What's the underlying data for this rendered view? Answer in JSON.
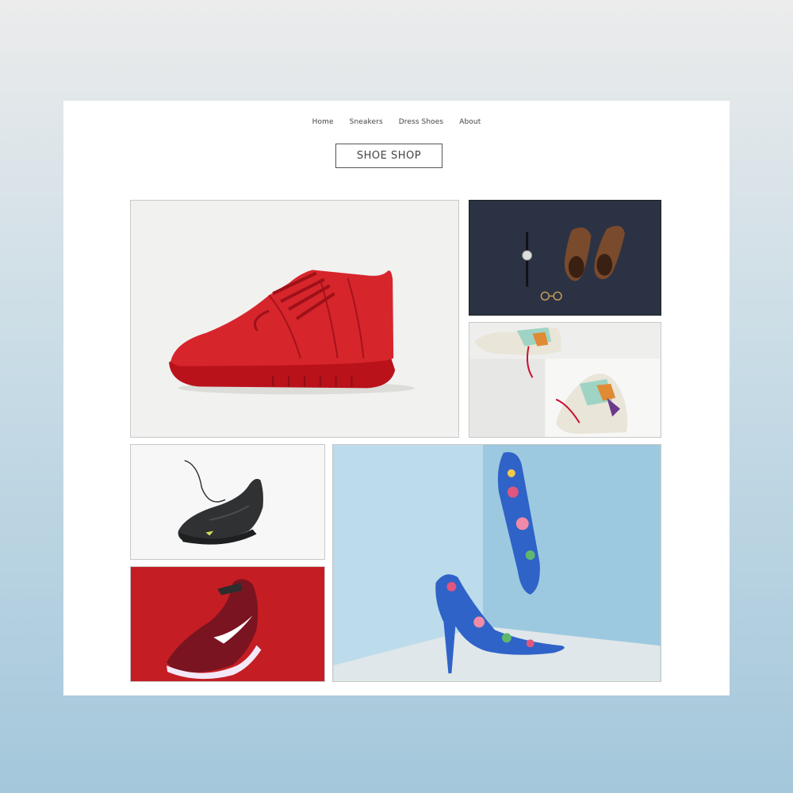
{
  "nav": {
    "items": [
      {
        "label": "Home"
      },
      {
        "label": "Sneakers"
      },
      {
        "label": "Dress Shoes"
      },
      {
        "label": "About"
      }
    ]
  },
  "logo": {
    "text": "SHOE SHOP"
  },
  "gallery": {
    "images": [
      {
        "subject": "red high-top sneaker"
      },
      {
        "subject": "brown leather shoes with watch and glasses"
      },
      {
        "subject": "colorful chunky sneakers"
      },
      {
        "subject": "black running shoe"
      },
      {
        "subject": "red running shoe on red background"
      },
      {
        "subject": "floral blue high heels"
      }
    ]
  },
  "colors": {
    "accent_red": "#c41d24",
    "sky": "#a9d3e6"
  }
}
